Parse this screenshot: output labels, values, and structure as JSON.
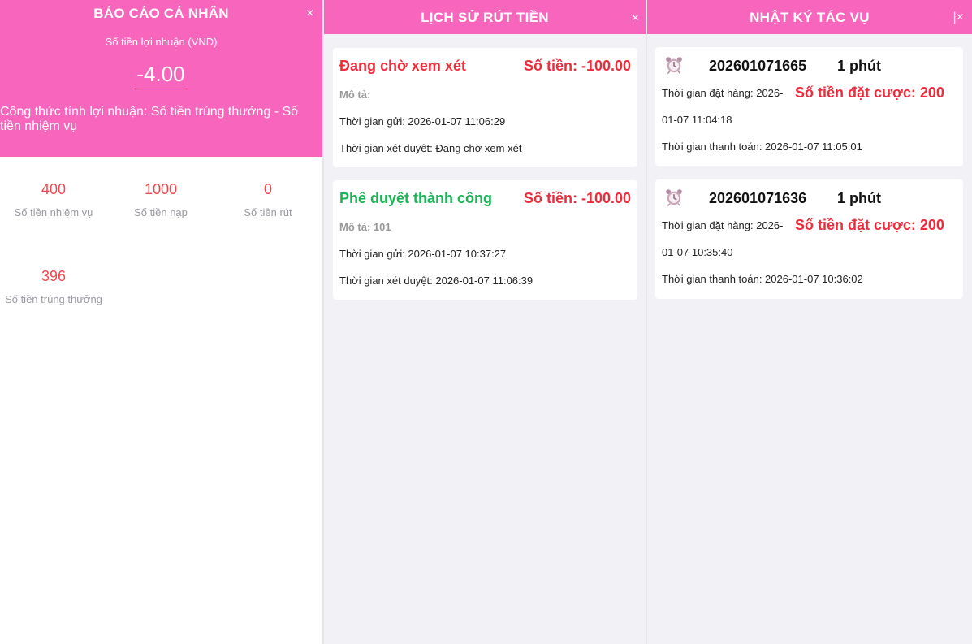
{
  "report": {
    "title": "BÁO CÁO CÁ NHÂN",
    "close": "×",
    "profit_label": "Số tiền lợi nhuận (VND)",
    "profit_value": "-4.00",
    "formula": "Công thức tính lợi nhuận: Số tiền trúng thưởng - Số tiền nhiệm vụ",
    "stats": [
      {
        "value": "400",
        "label": "Số tiền nhiệm vụ"
      },
      {
        "value": "1000",
        "label": "Số tiền nạp"
      },
      {
        "value": "0",
        "label": "Số tiền rút"
      },
      {
        "value": "396",
        "label": "Số tiền trúng thưởng"
      }
    ]
  },
  "withdraw": {
    "title": "LỊCH SỬ RÚT TIỀN",
    "close": "×",
    "records": [
      {
        "status": "Đang chờ xem xét",
        "status_color": "#ee2c3c",
        "amount": "Số tiền:  -100.00",
        "desc": "Mô tả:",
        "sent": "Thời gian gửi:  2026-01-07 11:06:29",
        "review": "Thời gian xét duyệt:  Đang chờ xem xét"
      },
      {
        "status": "Phê duyệt thành công",
        "status_color": "#1bb557",
        "amount": "Số tiền:  -100.00",
        "desc": "Mô tả:  101",
        "sent": "Thời gian gửi:  2026-01-07 10:37:27",
        "review": "Thời gian xét duyệt:  2026-01-07 11:06:39"
      }
    ]
  },
  "tasks": {
    "title": "NHẬT KÝ TÁC VỤ",
    "close": "|×",
    "records": [
      {
        "icon": "alarm-clock-icon",
        "id": "202601071665",
        "duration": "1 phút",
        "order_time_a": "Thời gian đặt hàng:  2026-",
        "order_time_b": "01-07 11:04:18",
        "bet": "Số tiền đặt cược:  200",
        "pay": "Thời gian thanh toán:  2026-01-07 11:05:01"
      },
      {
        "icon": "alarm-clock-icon",
        "id": "202601071636",
        "duration": "1 phút",
        "order_time_a": "Thời gian đặt hàng:  2026-",
        "order_time_b": "01-07 10:35:40",
        "bet": "Số tiền đặt cược:  200",
        "pay": "Thời gian thanh toán:  2026-01-07 10:36:02"
      }
    ]
  },
  "colors": {
    "brand_pink": "#f765bd",
    "amount_red": "#ee2c3c",
    "success_green": "#1bb557"
  }
}
